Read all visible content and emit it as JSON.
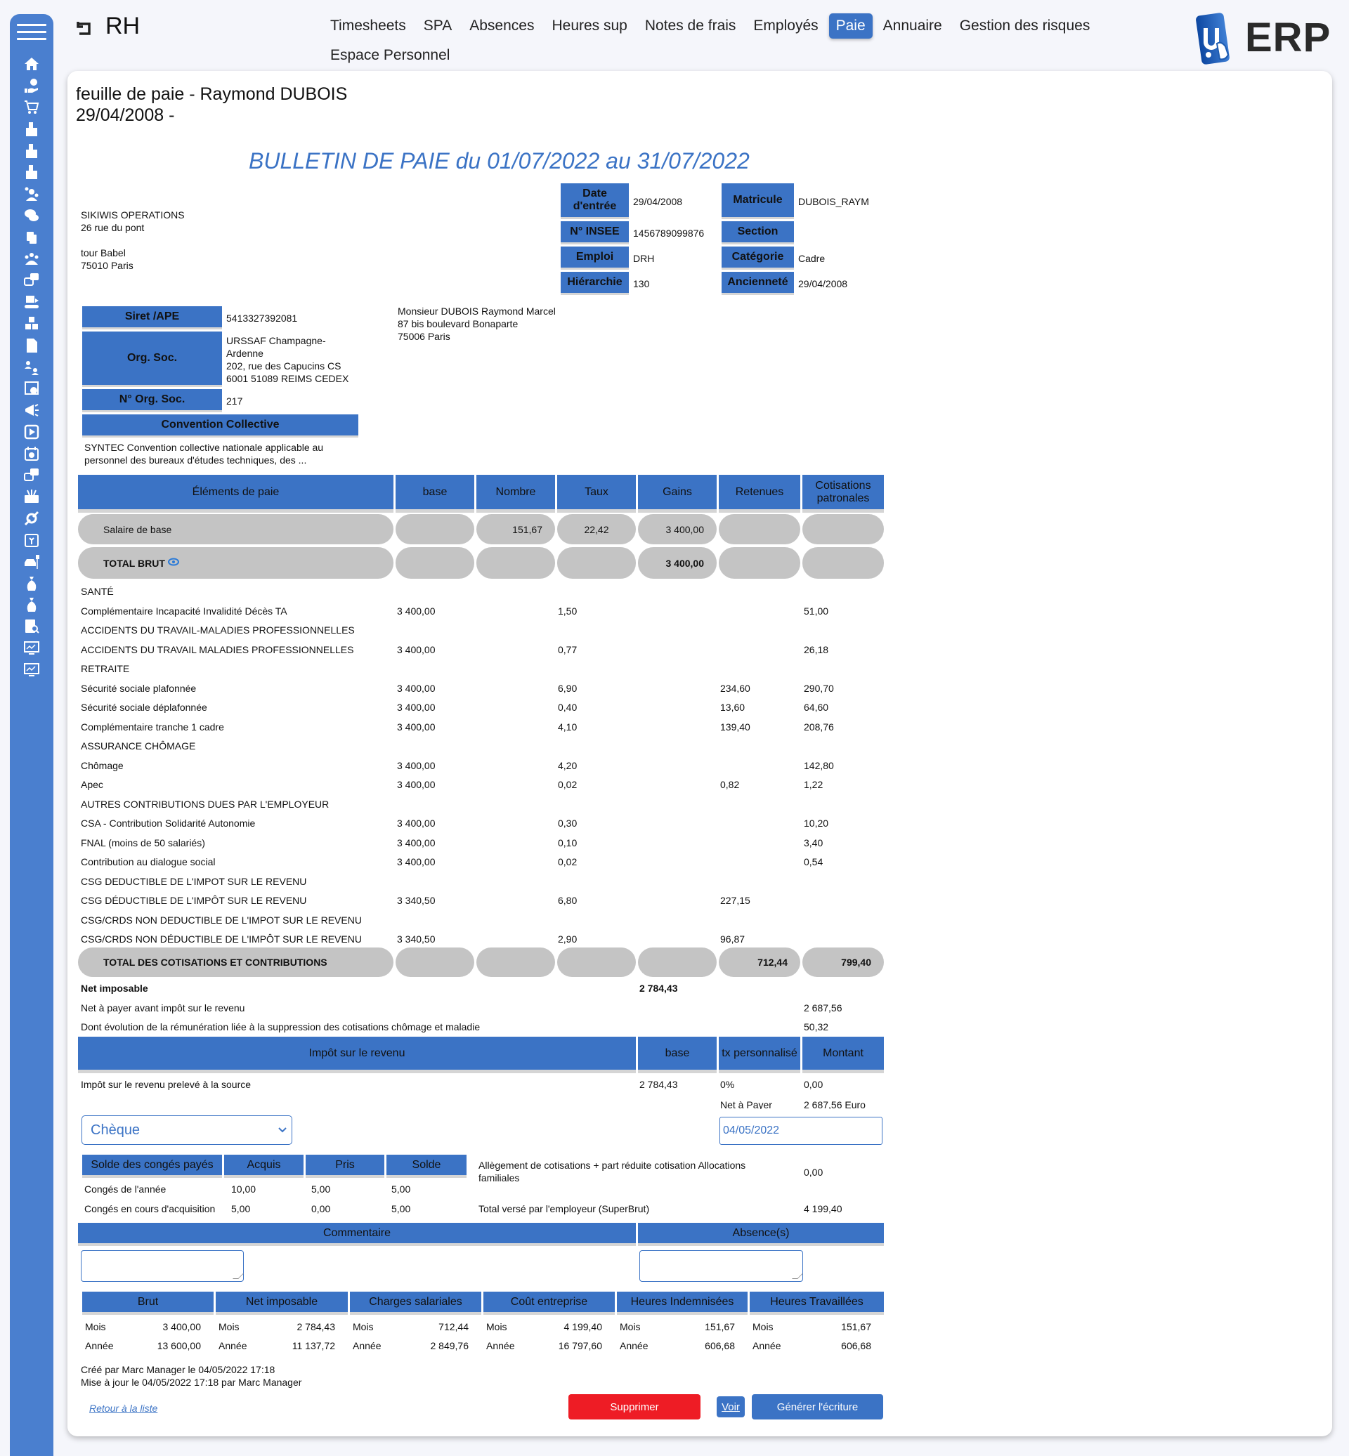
{
  "app": {
    "title": "RH",
    "logo_text": "ERP",
    "brand_color": "#3b73c5",
    "danger_color": "#ee1c25"
  },
  "sidebar": {
    "menu_icon": "hamburger-icon",
    "items": [
      {
        "icon": "home-icon"
      },
      {
        "icon": "money-hand-icon"
      },
      {
        "icon": "cart-icon"
      },
      {
        "icon": "building-icon"
      },
      {
        "icon": "building-icon"
      },
      {
        "icon": "building-icon"
      },
      {
        "icon": "team-settings-icon"
      },
      {
        "icon": "chat-icon"
      },
      {
        "icon": "documents-icon"
      },
      {
        "icon": "group-icon"
      },
      {
        "icon": "help-chat-icon"
      },
      {
        "icon": "conveyor-icon"
      },
      {
        "icon": "boxes-icon"
      },
      {
        "icon": "file-icon"
      },
      {
        "icon": "user-exchange-icon"
      },
      {
        "icon": "calendar-clock-icon"
      },
      {
        "icon": "megaphone-icon"
      },
      {
        "icon": "play-icon"
      },
      {
        "icon": "calendar-icon"
      },
      {
        "icon": "help-chat-icon"
      },
      {
        "icon": "toolbox-icon"
      },
      {
        "icon": "tools-icon"
      },
      {
        "icon": "calendar-plant-icon"
      },
      {
        "icon": "car-parking-icon"
      },
      {
        "icon": "money-bag-icon"
      },
      {
        "icon": "money-bag-icon"
      },
      {
        "icon": "clipboard-search-icon"
      },
      {
        "icon": "monitor-chart-icon"
      },
      {
        "icon": "monitor-chart-icon"
      }
    ]
  },
  "nav": {
    "row1": [
      {
        "label": "Timesheets",
        "active": false
      },
      {
        "label": "SPA",
        "active": false
      },
      {
        "label": "Absences",
        "active": false
      },
      {
        "label": "Heures sup",
        "active": false
      },
      {
        "label": "Notes de frais",
        "active": false
      },
      {
        "label": "Employés",
        "active": false
      },
      {
        "label": "Paie",
        "active": true
      },
      {
        "label": "Annuaire",
        "active": false
      },
      {
        "label": "Gestion des risques",
        "active": false
      }
    ],
    "row2": [
      {
        "label": "Espace Personnel",
        "active": false
      }
    ]
  },
  "page": {
    "title_line1": "feuille de paie - Raymond DUBOIS",
    "title_line2": "29/04/2008 -",
    "bulletin_title": "BULLETIN DE PAIE du 01/07/2022 au 31/07/2022"
  },
  "company": {
    "name": "SIKIWIS OPERATIONS",
    "address1": "26 rue du pont",
    "address2": "tour Babel",
    "city": "75010 Paris"
  },
  "employee_info": {
    "date_entree_label": "Date d'entrée",
    "date_entree": "29/04/2008",
    "insee_label": "N° INSEE",
    "insee": "1456789099876",
    "emploi_label": "Emploi",
    "emploi": "DRH",
    "hierarchie_label": "Hiérarchie",
    "hierarchie": "130",
    "matricule_label": "Matricule",
    "matricule": "DUBOIS_RAYM",
    "section_label": "Section",
    "section": "",
    "categorie_label": "Catégorie",
    "categorie": "Cadre",
    "anciennete_label": "Ancienneté",
    "anciennete": "29/04/2008"
  },
  "org": {
    "siret_label": "Siret /APE",
    "siret": "5413327392081",
    "org_soc_label": "Org. Soc.",
    "org_soc_line1": "URSSAF Champagne-",
    "org_soc_line2": "Ardenne",
    "org_soc_line3": "202, rue des Capucins CS",
    "org_soc_line4": "6001 51089 REIMS CEDEX",
    "num_org_label": "N° Org. Soc.",
    "num_org": "217",
    "convention_label": "Convention Collective",
    "convention_line1": "SYNTEC Convention collective nationale applicable au",
    "convention_line2": "personnel des bureaux d'études techniques, des ..."
  },
  "employee_address": {
    "name": "Monsieur DUBOIS Raymond Marcel",
    "street": "87 bis boulevard Bonaparte",
    "city": "75006 Paris"
  },
  "payslip": {
    "headers": {
      "elements": "Éléments de paie",
      "base": "base",
      "nombre": "Nombre",
      "taux": "Taux",
      "gains": "Gains",
      "retenues": "Retenues",
      "cotisations": "Cotisations patronales"
    },
    "salaire": {
      "label": "Salaire de base",
      "nombre": "151,67",
      "taux": "22,42",
      "gains": "3 400,00"
    },
    "total_brut": {
      "label": "TOTAL BRUT",
      "gains": "3 400,00"
    },
    "lines": [
      {
        "label": "SANTÉ",
        "base": "",
        "taux": "",
        "retenues": "",
        "patronales": ""
      },
      {
        "label": "Complémentaire Incapacité Invalidité Décès TA",
        "base": "3 400,00",
        "taux": "1,50",
        "retenues": "",
        "patronales": "51,00"
      },
      {
        "label": "ACCIDENTS DU TRAVAIL-MALADIES PROFESSIONNELLES",
        "base": "",
        "taux": "",
        "retenues": "",
        "patronales": ""
      },
      {
        "label": "ACCIDENTS DU TRAVAIL MALADIES PROFESSIONNELLES",
        "base": "3 400,00",
        "taux": "0,77",
        "retenues": "",
        "patronales": "26,18"
      },
      {
        "label": "RETRAITE",
        "base": "",
        "taux": "",
        "retenues": "",
        "patronales": ""
      },
      {
        "label": "Sécurité sociale plafonnée",
        "base": "3 400,00",
        "taux": "6,90",
        "retenues": "234,60",
        "patronales": "290,70"
      },
      {
        "label": "Sécurité sociale déplafonnée",
        "base": "3 400,00",
        "taux": "0,40",
        "retenues": "13,60",
        "patronales": "64,60"
      },
      {
        "label": "Complémentaire tranche 1 cadre",
        "base": "3 400,00",
        "taux": "4,10",
        "retenues": "139,40",
        "patronales": "208,76"
      },
      {
        "label": "ASSURANCE CHÔMAGE",
        "base": "",
        "taux": "",
        "retenues": "",
        "patronales": ""
      },
      {
        "label": "Chômage",
        "base": "3 400,00",
        "taux": "4,20",
        "retenues": "",
        "patronales": "142,80"
      },
      {
        "label": "Apec",
        "base": "3 400,00",
        "taux": "0,02",
        "retenues": "0,82",
        "patronales": "1,22"
      },
      {
        "label": "AUTRES CONTRIBUTIONS DUES PAR L'EMPLOYEUR",
        "base": "",
        "taux": "",
        "retenues": "",
        "patronales": ""
      },
      {
        "label": "CSA - Contribution Solidarité Autonomie",
        "base": "3 400,00",
        "taux": "0,30",
        "retenues": "",
        "patronales": "10,20"
      },
      {
        "label": "FNAL (moins de 50 salariés)",
        "base": "3 400,00",
        "taux": "0,10",
        "retenues": "",
        "patronales": "3,40"
      },
      {
        "label": "Contribution au dialogue social",
        "base": "3 400,00",
        "taux": "0,02",
        "retenues": "",
        "patronales": "0,54"
      },
      {
        "label": "CSG DEDUCTIBLE DE L'IMPOT SUR LE REVENU",
        "base": "",
        "taux": "",
        "retenues": "",
        "patronales": ""
      },
      {
        "label": "CSG DÉDUCTIBLE DE L'IMPÔT SUR LE REVENU",
        "base": "3 340,50",
        "taux": "6,80",
        "retenues": "227,15",
        "patronales": ""
      },
      {
        "label": "CSG/CRDS NON DEDUCTIBLE DE L'IMPOT SUR LE REVENU",
        "base": "",
        "taux": "",
        "retenues": "",
        "patronales": ""
      },
      {
        "label": "CSG/CRDS NON DÉDUCTIBLE DE L'IMPÔT SUR LE REVENU",
        "base": "3 340,50",
        "taux": "2,90",
        "retenues": "96,87",
        "patronales": ""
      }
    ],
    "total_cotisations": {
      "label": "TOTAL DES COTISATIONS ET CONTRIBUTIONS",
      "retenues": "712,44",
      "patronales": "799,40"
    },
    "net_imposable": {
      "label": "Net imposable",
      "value": "2 784,43"
    },
    "net_avant_impot": {
      "label": "Net à payer avant impôt sur le revenu",
      "value": "2 687,56"
    },
    "evolution": {
      "label": "Dont évolution de la rémunération liée à la suppression des cotisations chômage et maladie",
      "value": "50,32"
    }
  },
  "impot": {
    "headers": {
      "label": "Impôt sur le revenu",
      "base": "base",
      "taux": "tx personnalisé",
      "montant": "Montant"
    },
    "row": {
      "label": "Impôt sur le revenu prelevé à la source",
      "base": "2 784,43",
      "taux": "0%",
      "montant": "0,00"
    },
    "net_a_payer_label": "Net à Payer",
    "net_a_payer": "2 687,56 Euro"
  },
  "payment": {
    "method": "Chèque",
    "date": "04/05/2022"
  },
  "conges": {
    "headers": {
      "label": "Solde des congés payés",
      "acquis": "Acquis",
      "pris": "Pris",
      "solde": "Solde"
    },
    "rows": [
      {
        "label": "Congés de l'année",
        "acquis": "10,00",
        "pris": "5,00",
        "solde": "5,00"
      },
      {
        "label": "Congés en cours d'acquisition",
        "acquis": "5,00",
        "pris": "0,00",
        "solde": "5,00"
      }
    ],
    "allegement_label": "Allègement de cotisations + part réduite cotisation Allocations familiales",
    "allegement_value": "0,00",
    "superbrut_label": "Total versé par l'employeur (SuperBrut)",
    "superbrut_value": "4 199,40"
  },
  "comments": {
    "commentaire_label": "Commentaire",
    "commentaire_value": "",
    "absences_label": "Absence(s)",
    "absences_value": ""
  },
  "summary": {
    "mois_label": "Mois",
    "annee_label": "Année",
    "columns": [
      {
        "label": "Brut",
        "mois": "3 400,00",
        "annee": "13 600,00"
      },
      {
        "label": "Net imposable",
        "mois": "2 784,43",
        "annee": "11 137,72"
      },
      {
        "label": "Charges salariales",
        "mois": "712,44",
        "annee": "2 849,76"
      },
      {
        "label": "Coût entreprise",
        "mois": "4 199,40",
        "annee": "16 797,60"
      },
      {
        "label": "Heures Indemnisées",
        "mois": "151,67",
        "annee": "606,68"
      },
      {
        "label": "Heures Travaillées",
        "mois": "151,67",
        "annee": "606,68"
      }
    ]
  },
  "meta": {
    "created": "Créé par Marc Manager le 04/05/2022 17:18",
    "updated": "Mise à jour le 04/05/2022 17:18 par Marc Manager"
  },
  "actions": {
    "back_link": "Retour à la liste",
    "delete": "Supprimer",
    "view": "Voir",
    "generate": "Générer l'écriture"
  }
}
